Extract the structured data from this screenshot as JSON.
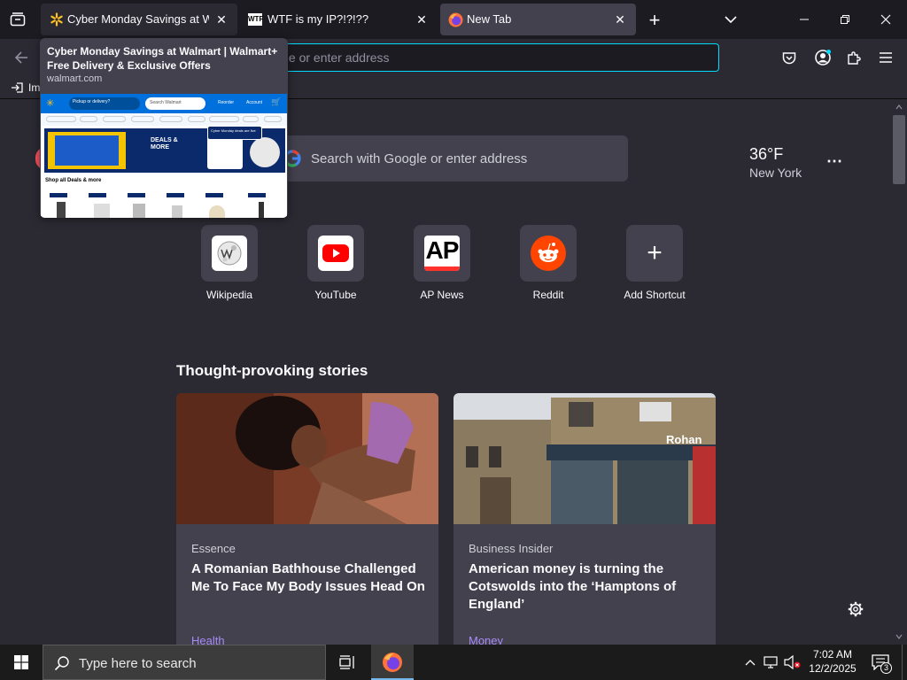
{
  "tabs": [
    {
      "title": "Cyber Monday Savings at Walmart",
      "icon": "walmart-spark-icon",
      "state": "hover"
    },
    {
      "title": "WTF is my IP?!?!??",
      "icon": "wtf-site-icon",
      "state": "normal"
    },
    {
      "title": "New Tab",
      "icon": "firefox-icon",
      "state": "active"
    }
  ],
  "tab_preview": {
    "title": "Cyber Monday Savings at Walmart | Walmart+ Free Delivery & Exclusive Offers",
    "url": "walmart.com",
    "thumbnail": {
      "pickup_text": "Pickup or delivery?",
      "search_placeholder": "Search Walmart",
      "reorder_label": "Reorder",
      "account_label": "Account",
      "banner_deals": "DEALS & MORE",
      "shop_heading": "Shop all Deals & more",
      "popup_text": "Cyber Monday deals are live"
    }
  },
  "urlbar": {
    "placeholder": "Search with Google or enter address",
    "visible_text": "gle or enter address"
  },
  "bookmarks": {
    "import_label": "Im"
  },
  "newtab": {
    "search_placeholder": "Search with Google or enter address",
    "weather": {
      "temp": "36°F",
      "location": "New York"
    },
    "shortcuts": [
      {
        "label": "Wikipedia",
        "icon": "wikipedia-icon"
      },
      {
        "label": "YouTube",
        "icon": "youtube-icon"
      },
      {
        "label": "AP News",
        "icon": "ap-news-icon"
      },
      {
        "label": "Reddit",
        "icon": "reddit-icon"
      },
      {
        "label": "Add Shortcut",
        "icon": "plus-icon"
      }
    ],
    "stories_heading": "Thought-provoking stories",
    "stories": [
      {
        "source": "Essence",
        "title": "A Romanian Bathhouse Challenged Me To Face My Body Issues Head On",
        "topic": "Health"
      },
      {
        "source": "Business Insider",
        "title": "American money is turning the Cotswolds into the ‘Hamptons of England’",
        "topic": "Money",
        "image_sign": "Rohan"
      }
    ]
  },
  "taskbar": {
    "search_placeholder": "Type here to search",
    "time": "7:02 AM",
    "date": "12/2/2025",
    "notification_count": "3"
  },
  "colors": {
    "accent": "#00ddff",
    "topic": "#a58bf5",
    "youtube_red": "#ff0000",
    "reddit_orange": "#ff4500",
    "walmart_blue": "#0071dc",
    "walmart_yellow": "#ffc220"
  }
}
